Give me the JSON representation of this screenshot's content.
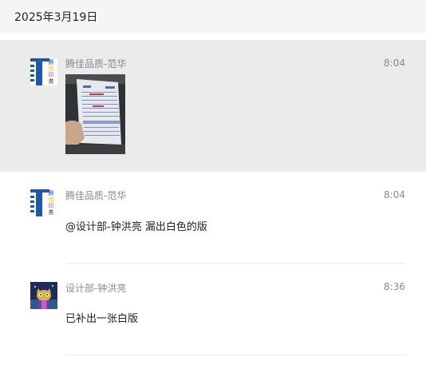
{
  "date_header": "2025年3月19日",
  "messages": [
    {
      "sender": "腾佳品质-范华",
      "time": "8:04",
      "avatar_chars": [
        "腾",
        "佳",
        "印",
        "务"
      ],
      "type": "image"
    },
    {
      "sender": "腾佳品质-范华",
      "time": "8:04",
      "avatar_chars": [
        "腾",
        "佳",
        "印",
        "务"
      ],
      "text": "@设计部-钟洪亮 漏出白色的版"
    },
    {
      "sender": "设计部-钟洪亮",
      "time": "8:36",
      "text": "已补出一张白版"
    }
  ],
  "colors": {
    "highlight_row": "#ebebeb",
    "logo_blue": "#1f58a8",
    "logo_yellow": "#e8c21c",
    "logo_pink": "#e64b9a",
    "meta_text": "#8a8a8a"
  }
}
